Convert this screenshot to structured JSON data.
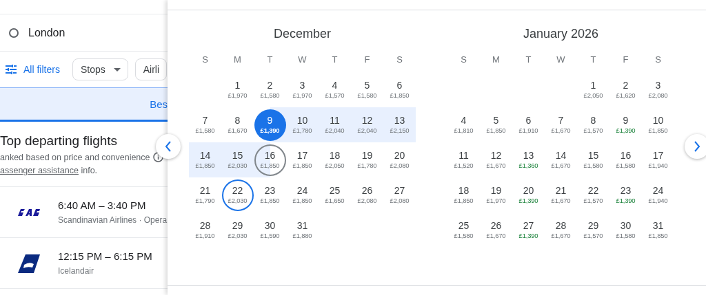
{
  "search": {
    "origin": "London"
  },
  "filters": {
    "all_filters": "All filters",
    "chips": [
      {
        "label": "Stops",
        "dropdown": true
      },
      {
        "label": "Airli",
        "dropdown": false
      }
    ]
  },
  "sort_tab": {
    "label": "Bes",
    "selected": true
  },
  "results": {
    "title": "Top departing flights",
    "subtitle": "anked based on price and convenience",
    "note_link": "assenger assistance",
    "note_rest": " info.",
    "flights": [
      {
        "kind": "sas",
        "times": "6:40 AM – 3:40 PM",
        "airline": "Scandinavian Airlines · Opera"
      },
      {
        "kind": "tail",
        "times": "12:15 PM – 6:15 PM",
        "airline": "Icelandair"
      }
    ]
  },
  "calendar": {
    "months": [
      {
        "title": "December",
        "weekdays": [
          "S",
          "M",
          "T",
          "W",
          "T",
          "F",
          "S"
        ],
        "days": [
          {
            "kind": "blank"
          },
          {
            "kind": "normal",
            "day": "1",
            "price": "£1,970",
            "cheap": false
          },
          {
            "kind": "normal",
            "day": "2",
            "price": "£1,580",
            "cheap": false
          },
          {
            "kind": "normal",
            "day": "3",
            "price": "£1,970",
            "cheap": false
          },
          {
            "kind": "normal",
            "day": "4",
            "price": "£1,570",
            "cheap": false
          },
          {
            "kind": "normal",
            "day": "5",
            "price": "£1,580",
            "cheap": false
          },
          {
            "kind": "normal",
            "day": "6",
            "price": "£1,850",
            "cheap": false
          },
          {
            "kind": "normal",
            "day": "7",
            "price": "£1,580",
            "cheap": false
          },
          {
            "kind": "normal",
            "day": "8",
            "price": "£1,670",
            "cheap": false
          },
          {
            "kind": "selected",
            "day": "9",
            "price": "£1,390",
            "cheap": false
          },
          {
            "kind": "range",
            "day": "10",
            "price": "£1,780",
            "cheap": false
          },
          {
            "kind": "range",
            "day": "11",
            "price": "£2,040",
            "cheap": false
          },
          {
            "kind": "range",
            "day": "12",
            "price": "£2,040",
            "cheap": false
          },
          {
            "kind": "range",
            "day": "13",
            "price": "£2,150",
            "cheap": false
          },
          {
            "kind": "range",
            "day": "14",
            "price": "£1,850",
            "cheap": false
          },
          {
            "kind": "range",
            "day": "15",
            "price": "£2,030",
            "cheap": false
          },
          {
            "kind": "hover",
            "day": "16",
            "price": "£1,850",
            "cheap": false
          },
          {
            "kind": "normal",
            "day": "17",
            "price": "£1,850",
            "cheap": false
          },
          {
            "kind": "normal",
            "day": "18",
            "price": "£2,050",
            "cheap": false
          },
          {
            "kind": "normal",
            "day": "19",
            "price": "£1,780",
            "cheap": false
          },
          {
            "kind": "normal",
            "day": "20",
            "price": "£2,080",
            "cheap": false
          },
          {
            "kind": "normal",
            "day": "21",
            "price": "£1,790",
            "cheap": false
          },
          {
            "kind": "today",
            "day": "22",
            "price": "£2,030",
            "cheap": false
          },
          {
            "kind": "normal",
            "day": "23",
            "price": "£1,850",
            "cheap": false
          },
          {
            "kind": "normal",
            "day": "24",
            "price": "£1,850",
            "cheap": false
          },
          {
            "kind": "normal",
            "day": "25",
            "price": "£1,650",
            "cheap": false
          },
          {
            "kind": "normal",
            "day": "26",
            "price": "£2,080",
            "cheap": false
          },
          {
            "kind": "normal",
            "day": "27",
            "price": "£2,080",
            "cheap": false
          },
          {
            "kind": "normal",
            "day": "28",
            "price": "£1,910",
            "cheap": false
          },
          {
            "kind": "normal",
            "day": "29",
            "price": "£2,030",
            "cheap": false
          },
          {
            "kind": "normal",
            "day": "30",
            "price": "£1,590",
            "cheap": false
          },
          {
            "kind": "normal",
            "day": "31",
            "price": "£1,880",
            "cheap": false
          }
        ]
      },
      {
        "title": "January 2026",
        "weekdays": [
          "S",
          "M",
          "T",
          "W",
          "T",
          "F",
          "S"
        ],
        "days": [
          {
            "kind": "blank"
          },
          {
            "kind": "blank"
          },
          {
            "kind": "blank"
          },
          {
            "kind": "blank"
          },
          {
            "kind": "normal",
            "day": "1",
            "price": "£2,050",
            "cheap": false
          },
          {
            "kind": "normal",
            "day": "2",
            "price": "£1,620",
            "cheap": false
          },
          {
            "kind": "normal",
            "day": "3",
            "price": "£2,080",
            "cheap": false
          },
          {
            "kind": "normal",
            "day": "4",
            "price": "£1,810",
            "cheap": false
          },
          {
            "kind": "normal",
            "day": "5",
            "price": "£1,850",
            "cheap": false
          },
          {
            "kind": "normal",
            "day": "6",
            "price": "£1,910",
            "cheap": false
          },
          {
            "kind": "normal",
            "day": "7",
            "price": "£1,670",
            "cheap": false
          },
          {
            "kind": "normal",
            "day": "8",
            "price": "£1,570",
            "cheap": false
          },
          {
            "kind": "normal",
            "day": "9",
            "price": "£1,390",
            "cheap": true
          },
          {
            "kind": "normal",
            "day": "10",
            "price": "£1,850",
            "cheap": false
          },
          {
            "kind": "normal",
            "day": "11",
            "price": "£1,520",
            "cheap": false
          },
          {
            "kind": "normal",
            "day": "12",
            "price": "£1,670",
            "cheap": false
          },
          {
            "kind": "normal",
            "day": "13",
            "price": "£1,360",
            "cheap": true
          },
          {
            "kind": "normal",
            "day": "14",
            "price": "£1,670",
            "cheap": false
          },
          {
            "kind": "normal",
            "day": "15",
            "price": "£1,580",
            "cheap": false
          },
          {
            "kind": "normal",
            "day": "16",
            "price": "£1,580",
            "cheap": false
          },
          {
            "kind": "normal",
            "day": "17",
            "price": "£1,940",
            "cheap": false
          },
          {
            "kind": "normal",
            "day": "18",
            "price": "£1,850",
            "cheap": false
          },
          {
            "kind": "normal",
            "day": "19",
            "price": "£1,970",
            "cheap": false
          },
          {
            "kind": "normal",
            "day": "20",
            "price": "£1,390",
            "cheap": true
          },
          {
            "kind": "normal",
            "day": "21",
            "price": "£1,670",
            "cheap": false
          },
          {
            "kind": "normal",
            "day": "22",
            "price": "£1,570",
            "cheap": false
          },
          {
            "kind": "normal",
            "day": "23",
            "price": "£1,390",
            "cheap": true
          },
          {
            "kind": "normal",
            "day": "24",
            "price": "£1,940",
            "cheap": false
          },
          {
            "kind": "normal",
            "day": "25",
            "price": "£1,580",
            "cheap": false
          },
          {
            "kind": "normal",
            "day": "26",
            "price": "£1,670",
            "cheap": false
          },
          {
            "kind": "normal",
            "day": "27",
            "price": "£1,390",
            "cheap": true
          },
          {
            "kind": "normal",
            "day": "28",
            "price": "£1,670",
            "cheap": false
          },
          {
            "kind": "normal",
            "day": "29",
            "price": "£1,570",
            "cheap": false
          },
          {
            "kind": "normal",
            "day": "30",
            "price": "£1,580",
            "cheap": false
          },
          {
            "kind": "normal",
            "day": "31",
            "price": "£1,850",
            "cheap": false
          }
        ]
      }
    ]
  }
}
